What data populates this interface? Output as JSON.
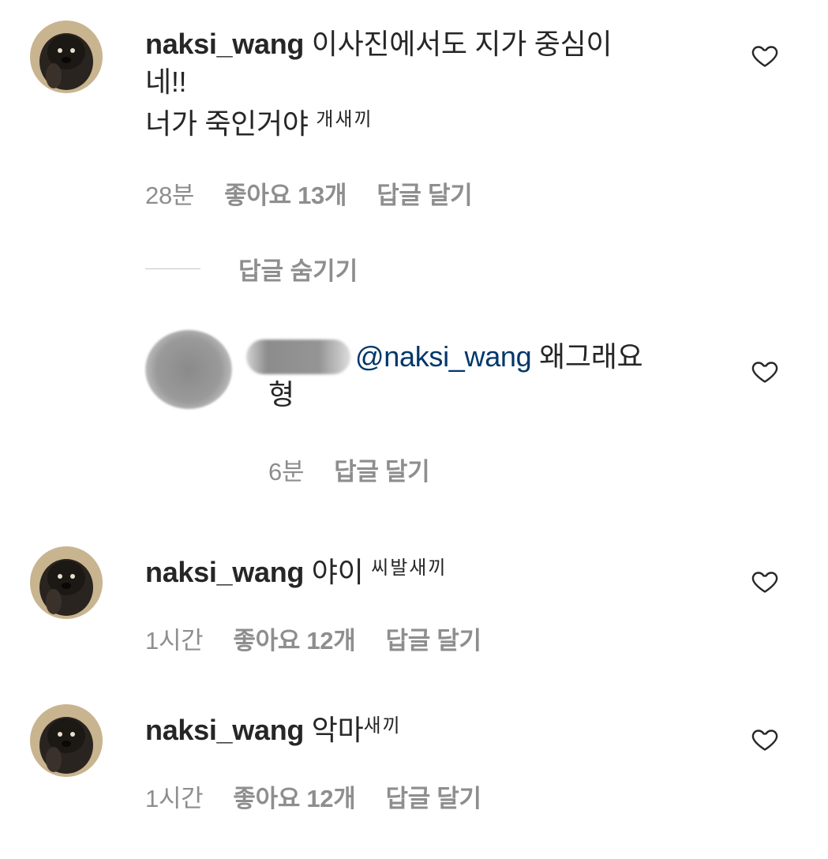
{
  "comments": [
    {
      "username": "naksi_wang",
      "text_line1": " 이사진에서도 지가 중심이",
      "text_line2": "네!!",
      "text_line3": "너가 죽인거야 ",
      "censored": "개새끼",
      "time": "28분",
      "likes": "좋아요 13개",
      "reply": "답글 달기",
      "avatar_icon": "dog-photo-avatar",
      "like_icon": "heart-outline-icon"
    },
    {
      "username": "naksi_wang",
      "text": " 야이 ",
      "censored": "씨발새끼",
      "time": "1시간",
      "likes": "좋아요 12개",
      "reply": "답글 달기",
      "avatar_icon": "dog-photo-avatar",
      "like_icon": "heart-outline-icon"
    },
    {
      "username": "naksi_wang",
      "text": " 악마",
      "censored": "새끼",
      "time": "1시간",
      "likes": "좋아요 12개",
      "reply": "답글 달기",
      "avatar_icon": "dog-photo-avatar",
      "like_icon": "heart-outline-icon"
    }
  ],
  "hide_replies": "답글 숨기기",
  "reply_comment": {
    "mention": "@naksi_wang",
    "text_line1": " 왜그래요",
    "text_line2": "형",
    "time": "6분",
    "reply": "답글 달기",
    "avatar_icon": "blurred-avatar",
    "like_icon": "heart-outline-icon"
  },
  "colors": {
    "text": "#262626",
    "meta": "#8e8e8e",
    "mention": "#00376b"
  }
}
